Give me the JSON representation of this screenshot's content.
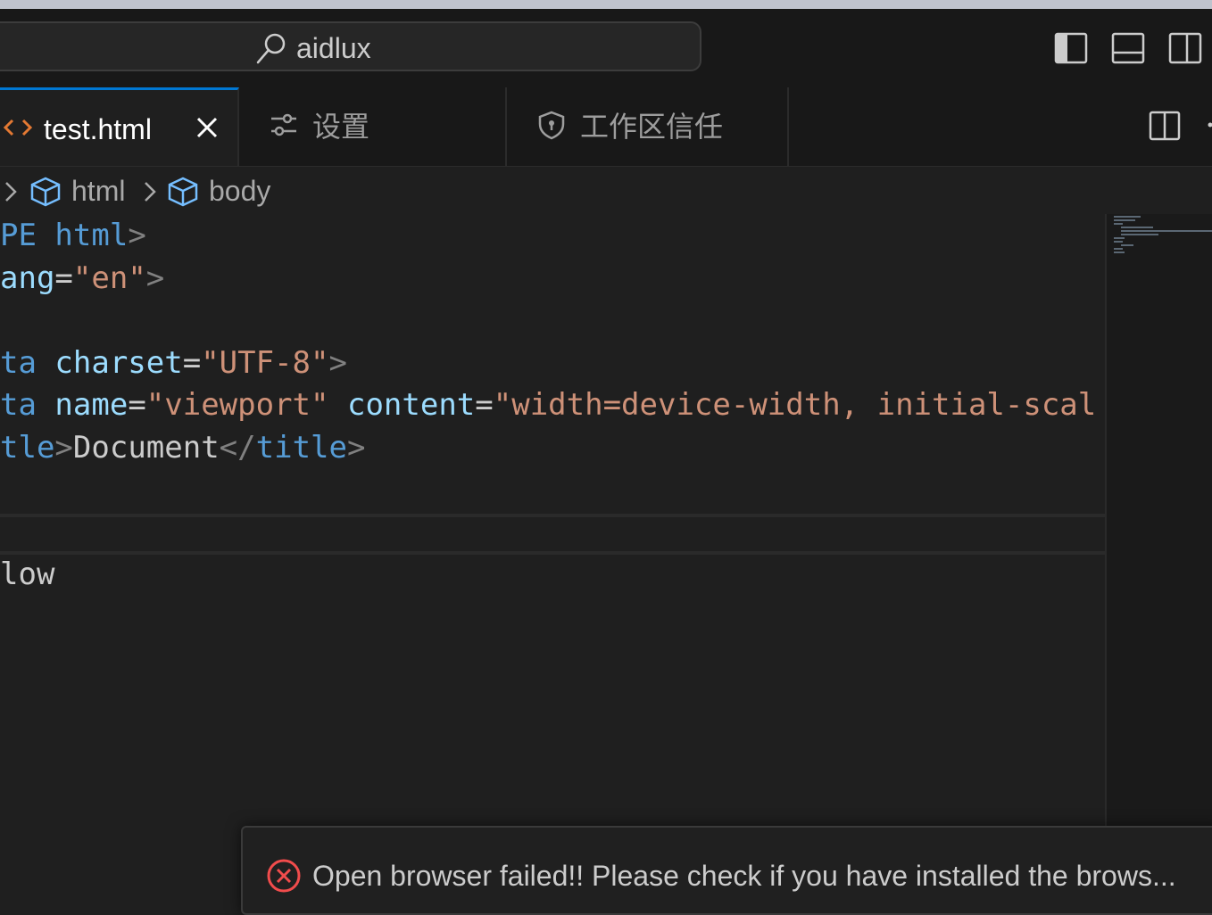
{
  "title_bar": {
    "search_text": "aidlux",
    "layout_buttons": [
      "toggle-primary-sidebar-icon",
      "toggle-panel-icon",
      "toggle-secondary-sidebar-icon"
    ]
  },
  "tabs": [
    {
      "label": "test.html",
      "icon": "html-file-icon",
      "active": true,
      "close": "close-icon"
    },
    {
      "label": "设置",
      "icon": "settings-sliders-icon",
      "active": false
    },
    {
      "label": "工作区信任",
      "icon": "shield-icon",
      "active": false
    }
  ],
  "breadcrumbs": [
    {
      "label": "html",
      "icon": "cube-icon"
    },
    {
      "label": "body",
      "icon": "cube-icon"
    }
  ],
  "code_lines": [
    {
      "frag": [
        "PE",
        " html",
        ">"
      ]
    },
    {
      "frag": [
        "ang",
        "=",
        "\"en\"",
        ">"
      ]
    },
    {
      "frag": []
    },
    {
      "frag": [
        "ta",
        " charset",
        "=",
        "\"UTF-8\"",
        ">"
      ]
    },
    {
      "frag": [
        "ta",
        " name",
        "=",
        "\"viewport\"",
        " content",
        "=",
        "\"width=device-width, initial-scal"
      ]
    },
    {
      "frag": [
        "tle",
        ">",
        "Document",
        "</",
        "title",
        ">"
      ]
    },
    {
      "frag": []
    },
    {
      "frag": []
    },
    {
      "frag": [
        "low"
      ]
    }
  ],
  "notification": {
    "message": "Open browser failed!! Please check if you have installed the brows...",
    "icon": "error-icon"
  },
  "colors": {
    "accent": "#0078d4",
    "tag": "#569cd6",
    "attr": "#9cdcfe",
    "string": "#ce9178",
    "error": "#f14c4c"
  }
}
